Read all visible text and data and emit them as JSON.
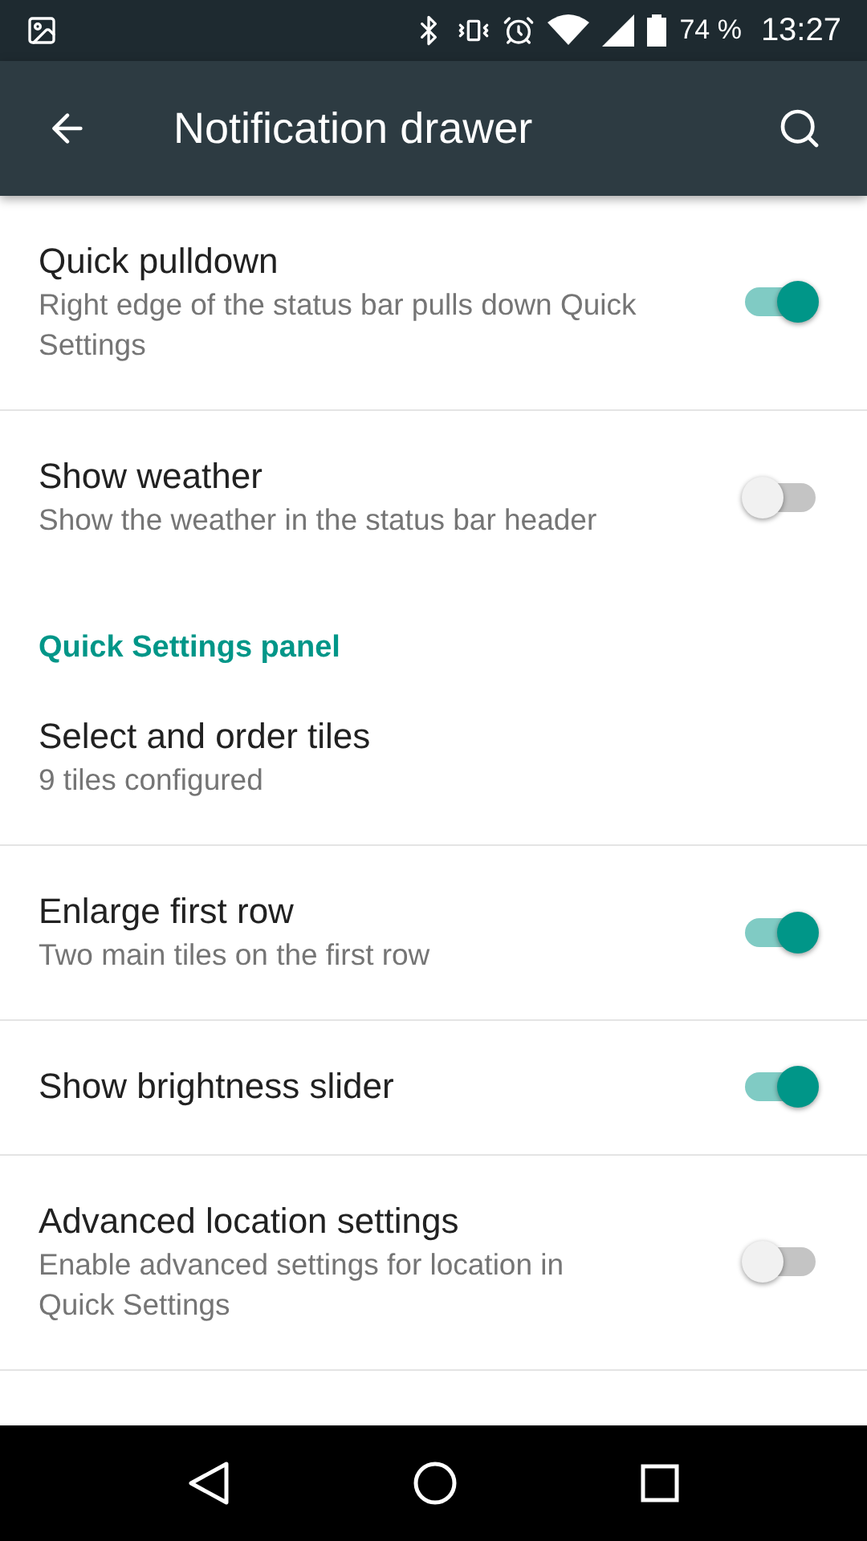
{
  "status_bar": {
    "battery": "74 %",
    "time": "13:27"
  },
  "toolbar": {
    "title": "Notification drawer"
  },
  "settings": [
    {
      "kind": "switch",
      "title": "Quick pulldown",
      "summary": "Right edge of the status bar pulls down Quick Settings",
      "on": true
    },
    {
      "kind": "switch",
      "title": "Show weather",
      "summary": "Show the weather in the status bar header",
      "on": false
    },
    {
      "kind": "header",
      "title": "Quick Settings panel"
    },
    {
      "kind": "plain",
      "title": "Select and order tiles",
      "summary": "9 tiles configured"
    },
    {
      "kind": "switch",
      "title": "Enlarge first row",
      "summary": "Two main tiles on the first row",
      "on": true
    },
    {
      "kind": "switch",
      "title": "Show brightness slider",
      "on": true
    },
    {
      "kind": "switch",
      "title": "Advanced location settings",
      "summary": "Enable advanced settings for location in Quick Settings",
      "on": false
    }
  ]
}
